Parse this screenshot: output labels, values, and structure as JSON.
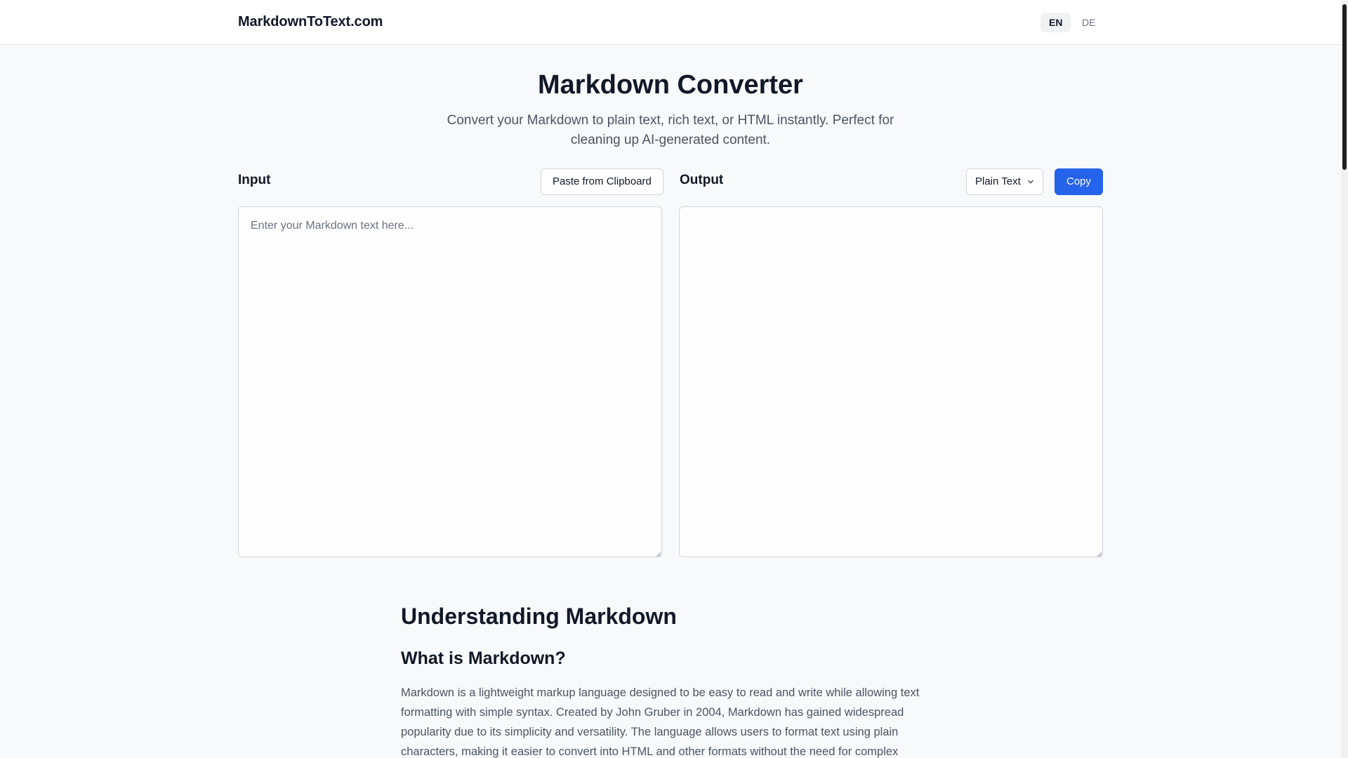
{
  "header": {
    "logo": "MarkdownToText.com",
    "languages": {
      "en": "EN",
      "de": "DE",
      "active": "EN"
    }
  },
  "hero": {
    "title": "Markdown Converter",
    "subtitle": "Convert your Markdown to plain text, rich text, or HTML instantly. Perfect for cleaning up AI-generated content."
  },
  "input_panel": {
    "label": "Input",
    "paste_button": "Paste from Clipboard",
    "placeholder": "Enter your Markdown text here...",
    "value": ""
  },
  "output_panel": {
    "label": "Output",
    "format_select": {
      "selected": "Plain Text",
      "icon": "chevron-down-icon"
    },
    "copy_button": "Copy",
    "value": ""
  },
  "article": {
    "heading": "Understanding Markdown",
    "subheading": "What is Markdown?",
    "paragraph": "Markdown is a lightweight markup language designed to be easy to read and write while allowing text formatting with simple syntax. Created by John Gruber in 2004, Markdown has gained widespread popularity due to its simplicity and versatility. The language allows users to format text using plain characters, making it easier to convert into HTML and other formats without the need for complex"
  },
  "colors": {
    "accent": "#2563eb",
    "background": "#f8f9fb",
    "text_primary": "#111827",
    "text_secondary": "#4b5563"
  }
}
